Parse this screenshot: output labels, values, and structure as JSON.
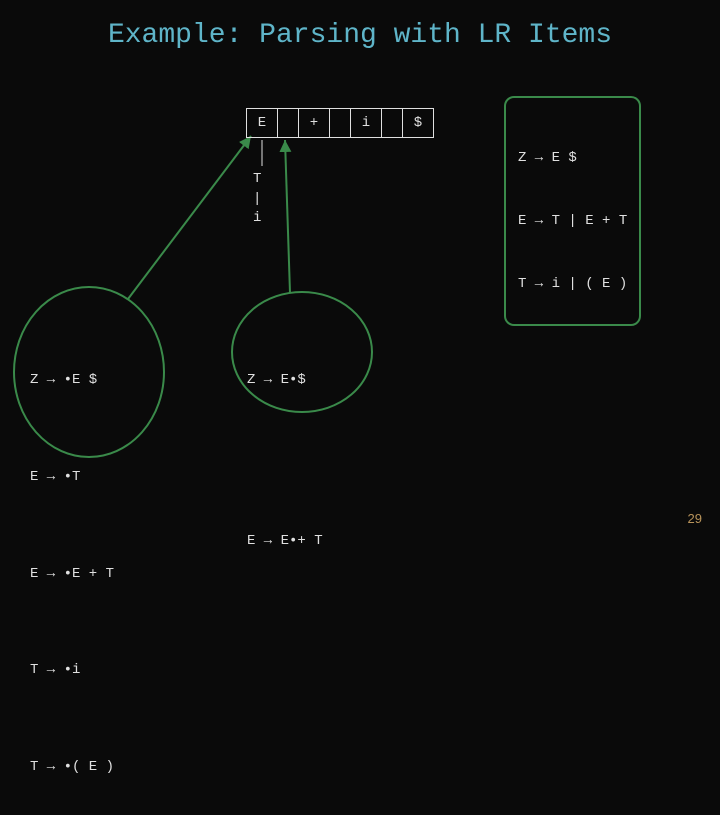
{
  "title": "Example: Parsing with LR Items",
  "input": {
    "cells": [
      "E",
      "",
      "+",
      "",
      "i",
      "",
      "$"
    ]
  },
  "grammar": [
    "Z → E $",
    "E → T | E + T",
    "T → i | ( E )"
  ],
  "derivation": [
    "T",
    "|",
    "i"
  ],
  "left_state": {
    "items": [
      "Z → •E $",
      "E → •T",
      "E → •E + T",
      "T → •i",
      "T → •( E )"
    ]
  },
  "right_state": {
    "items": [
      "Z → E•$",
      "",
      "E → E•+ T"
    ]
  },
  "page_number": "29"
}
